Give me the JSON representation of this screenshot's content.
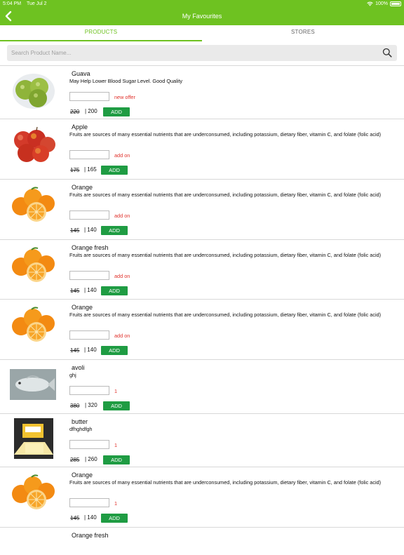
{
  "status": {
    "time": "5:04 PM",
    "date": "Tue Jul 2",
    "battery": "100%"
  },
  "header": {
    "title": "My Favourites",
    "accent": "#6ec221"
  },
  "tabs": [
    {
      "label": "PRODUCTS"
    },
    {
      "label": "STORES"
    }
  ],
  "search": {
    "placeholder": "Search Product Name..."
  },
  "products": [
    {
      "name": "Guava",
      "description": "May Help Lower Blood Sugar Level. Good Quality",
      "offer": "new offer",
      "mrp": "220",
      "price": "| 200",
      "button": "ADD",
      "image": "guava"
    },
    {
      "name": "Apple",
      "description": "Fruits are sources of many essential nutrients that are underconsumed, including potassium, dietary fiber, vitamin C, and folate (folic acid)",
      "offer": "add on",
      "mrp": "175",
      "price": "| 165",
      "button": "ADD",
      "image": "apple"
    },
    {
      "name": "Orange",
      "description": "Fruits are sources of many essential nutrients that are underconsumed, including potassium, dietary fiber, vitamin C, and folate (folic acid)",
      "offer": "add on",
      "mrp": "145",
      "price": "| 140",
      "button": "ADD",
      "image": "orange"
    },
    {
      "name": "Orange fresh",
      "description": "Fruits are sources of many essential nutrients that are underconsumed, including potassium, dietary fiber, vitamin C, and folate (folic acid)",
      "offer": "add on",
      "mrp": "145",
      "price": "| 140",
      "button": "ADD",
      "image": "orange"
    },
    {
      "name": "Orange",
      "description": "Fruits are sources of many essential nutrients that are underconsumed, including potassium, dietary fiber, vitamin C, and folate (folic acid)",
      "offer": "add on",
      "mrp": "145",
      "price": "| 140",
      "button": "ADD",
      "image": "orange"
    },
    {
      "name": "avoli",
      "description": "ghj",
      "offer": "1",
      "mrp": "380",
      "price": "| 320",
      "button": "ADD",
      "image": "fish"
    },
    {
      "name": "butter",
      "description": "dfhghdfgh",
      "offer": "1",
      "mrp": "285",
      "price": "| 260",
      "button": "ADD",
      "image": "butter"
    },
    {
      "name": "Orange",
      "description": "Fruits are sources of many essential nutrients that are underconsumed, including potassium, dietary fiber, vitamin C, and folate (folic acid)",
      "offer": "1",
      "mrp": "145",
      "price": "| 140",
      "button": "ADD",
      "image": "orange"
    },
    {
      "name": "Orange fresh",
      "description": "",
      "offer": "",
      "mrp": "",
      "price": "",
      "button": "",
      "image": ""
    }
  ]
}
